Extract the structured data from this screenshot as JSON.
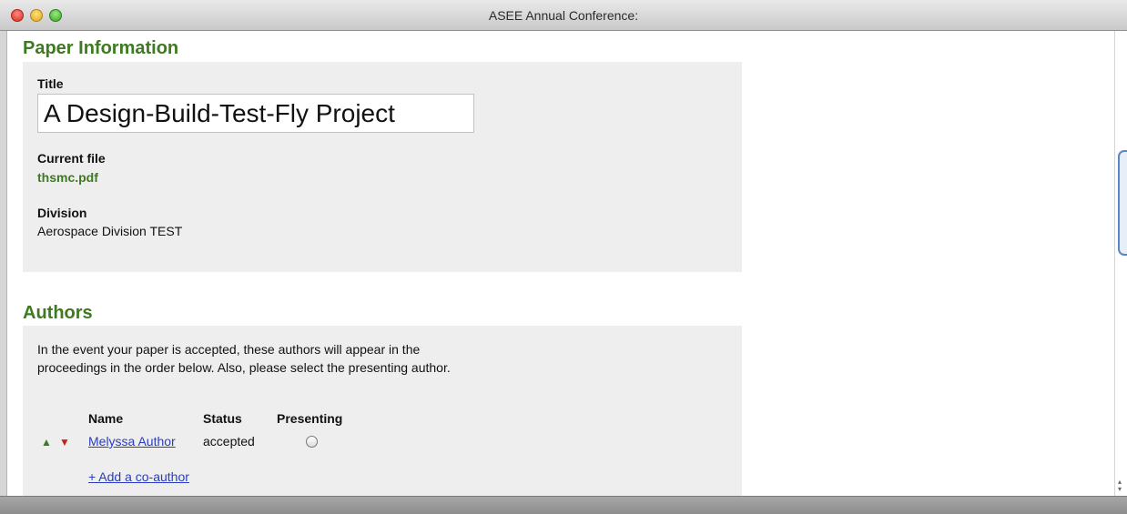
{
  "window": {
    "title": "ASEE Annual Conference:"
  },
  "paper_info": {
    "heading": "Paper Information",
    "title_label": "Title",
    "title_value": "A Design-Build-Test-Fly Project",
    "current_file_label": "Current file",
    "current_file_name": "thsmc.pdf",
    "division_label": "Division",
    "division_value": "Aerospace Division TEST"
  },
  "authors": {
    "heading": "Authors",
    "intro": "In the event your paper is accepted, these authors will appear in the proceedings in the order below. Also, please select the presenting author.",
    "columns": {
      "name": "Name",
      "status": "Status",
      "presenting": "Presenting"
    },
    "rows": [
      {
        "name": "Melyssa Author",
        "status": "accepted",
        "presenting": false
      }
    ],
    "move_up_symbol": "▲",
    "move_down_symbol": "▼",
    "add_coauthor_label": "+ Add a co-author"
  },
  "colors": {
    "heading_green": "#3d7a20",
    "panel_gray": "#eeeeee",
    "link_blue": "#2a3dbf",
    "down_arrow_red": "#cc1f1f"
  }
}
